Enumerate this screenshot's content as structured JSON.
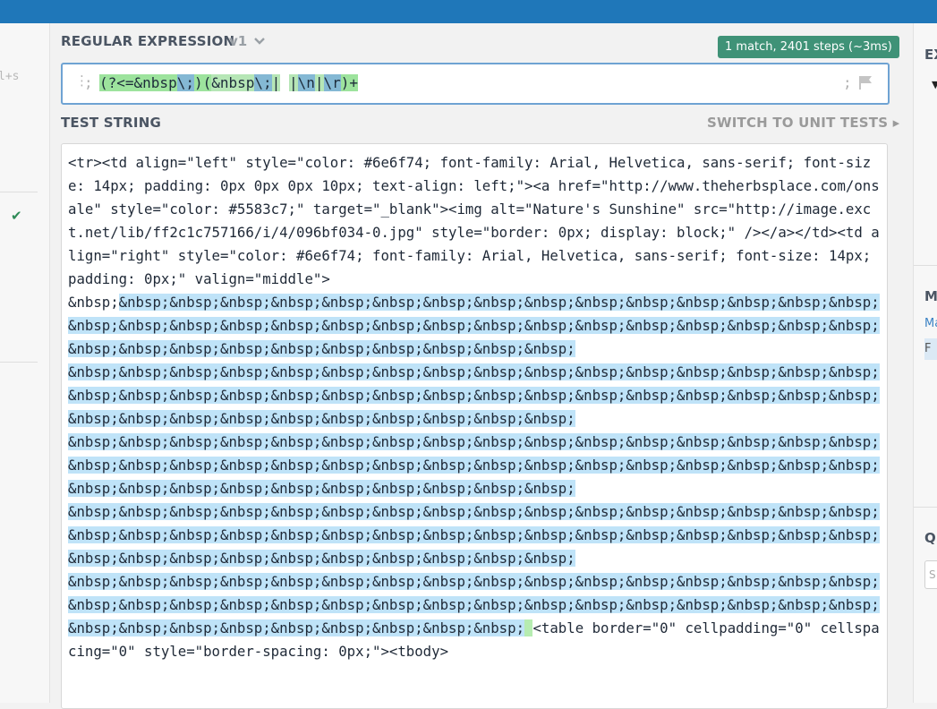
{
  "left_panel": {
    "flags_fragment": "l+s"
  },
  "editor": {
    "regex_label": "REGULAR EXPRESSION",
    "version": "v1",
    "match_info": "1 match, 2401 steps (~3ms)",
    "delimiter_open": ";",
    "delimiter_close": ";",
    "test_label": "TEST STRING",
    "switch_label": "SWITCH TO UNIT TESTS ▸",
    "regex_parts": [
      "(?<=",
      "&nbsp",
      "\\;",
      ")(",
      "&nbsp",
      "\\;",
      "|",
      " ",
      "|",
      "\\n",
      "|",
      "\\r",
      ")+"
    ],
    "test_pre": "<tr><td align=\"left\" style=\"color: #6e6f74; font-family: Arial, Helvetica, sans-serif; font-size: 14px; padding: 0px 0px 0px 10px; text-align: left;\"><a href=\"http://www.theherbsplace.com/onsale\" style=\"color: #5583c7;\" target=\"_blank\"><img alt=\"Nature's Sunshine\" src=\"http://image.exct.net/lib/ff2c1c757166/i/4/096bf034-0.jpg\" style=\"border: 0px; display: block;\" /></a></td><td align=\"right\" style=\"color: #6e6f74; font-family: Arial, Helvetica, sans-serif; font-size: 14px; padding: 0px;\" valign=\"middle\">\n&nbsp;",
    "test_match_lines": [
      "&nbsp;&nbsp;&nbsp;&nbsp;&nbsp;&nbsp;&nbsp;&nbsp;&nbsp;&nbsp;&nbsp;&nbsp;&nbsp;&nbsp;&nbsp;&nbsp;&nbsp;&nbsp;&nbsp;&nbsp;&nbsp;&nbsp;&nbsp;&nbsp;&nbsp;&nbsp;&nbsp;&nbsp;&nbsp;&nbsp;&nbsp;&nbsp;&nbsp;&nbsp;&nbsp;&nbsp;&nbsp;&nbsp;&nbsp;&nbsp;&nbsp;",
      "&nbsp;&nbsp;&nbsp;&nbsp;&nbsp;&nbsp;&nbsp;&nbsp;&nbsp;&nbsp;&nbsp;&nbsp;&nbsp;&nbsp;&nbsp;&nbsp;&nbsp;&nbsp;&nbsp;&nbsp;&nbsp;&nbsp;&nbsp;&nbsp;&nbsp;&nbsp;&nbsp;&nbsp;&nbsp;&nbsp;&nbsp;&nbsp;&nbsp;&nbsp;&nbsp;&nbsp;&nbsp;&nbsp;&nbsp;&nbsp;&nbsp;&nbsp;",
      "&nbsp;&nbsp;&nbsp;&nbsp;&nbsp;&nbsp;&nbsp;&nbsp;&nbsp;&nbsp;&nbsp;&nbsp;&nbsp;&nbsp;&nbsp;&nbsp;&nbsp;&nbsp;&nbsp;&nbsp;&nbsp;&nbsp;&nbsp;&nbsp;&nbsp;&nbsp;&nbsp;&nbsp;&nbsp;&nbsp;&nbsp;&nbsp;&nbsp;&nbsp;&nbsp;&nbsp;&nbsp;&nbsp;&nbsp;&nbsp;&nbsp;&nbsp;",
      "&nbsp;&nbsp;&nbsp;&nbsp;&nbsp;&nbsp;&nbsp;&nbsp;&nbsp;&nbsp;&nbsp;&nbsp;&nbsp;&nbsp;&nbsp;&nbsp;&nbsp;&nbsp;&nbsp;&nbsp;&nbsp;&nbsp;&nbsp;&nbsp;&nbsp;&nbsp;&nbsp;&nbsp;&nbsp;&nbsp;&nbsp;&nbsp;&nbsp;&nbsp;&nbsp;&nbsp;&nbsp;&nbsp;&nbsp;&nbsp;&nbsp;&nbsp;",
      "&nbsp;&nbsp;&nbsp;&nbsp;&nbsp;&nbsp;&nbsp;&nbsp;&nbsp;&nbsp;&nbsp;&nbsp;&nbsp;&nbsp;&nbsp;&nbsp;&nbsp;&nbsp;&nbsp;&nbsp;&nbsp;&nbsp;&nbsp;&nbsp;&nbsp;&nbsp;&nbsp;&nbsp;&nbsp;&nbsp;&nbsp;&nbsp;&nbsp;&nbsp;&nbsp;&nbsp;&nbsp;&nbsp;&nbsp;&nbsp;&nbsp;"
    ],
    "test_match_end": " ",
    "test_post": "<table border=\"0\" cellpadding=\"0\" cellspacing=\"0\" style=\"border-spacing: 0px;\"><tbody>"
  },
  "right_panel": {
    "explanation_title": "EX",
    "match_info_title": "M",
    "match_info_link": "Ma",
    "match_row": "F",
    "quick_ref_title": "Q",
    "search_placeholder": "S"
  },
  "colors": {
    "topbar": "#1f77b9",
    "match_badge": "#3f9277",
    "match_highlight": "#bfe3f8",
    "group_highlight": "#9de39d"
  },
  "icons": [
    "chevron-down-icon",
    "drag-handle-icon",
    "flag-icon",
    "chevron-right-icon",
    "check-icon",
    "caret-down-icon"
  ]
}
